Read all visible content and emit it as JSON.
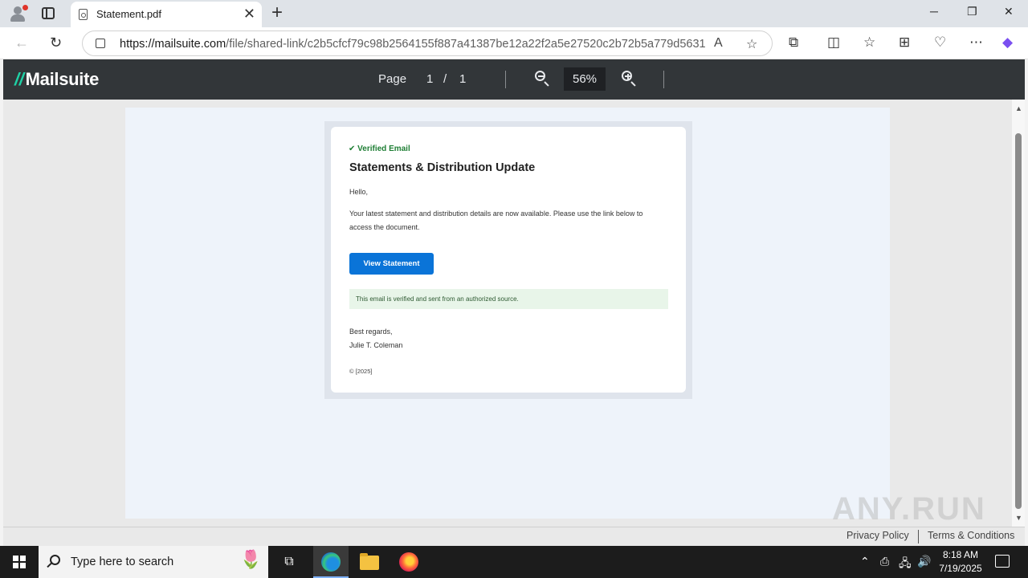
{
  "browser": {
    "tab_title": "Statement.pdf",
    "new_tab_symbol": "+",
    "close_symbol": "✕",
    "url_domain": "https://mailsuite.com",
    "url_path": "/file/shared-link/c2b5cfcf79c98b2564155f887a41387be12a22f2a5e27520c2b72b5a779d5631?...",
    "window_controls": {
      "minimize": "─",
      "restore": "❐",
      "close": "✕"
    }
  },
  "viewer": {
    "logo_text": "Mailsuite",
    "logo_mark": "//",
    "page_label": "Page",
    "current_page": "1",
    "page_separator": "/",
    "total_pages": "1",
    "zoom": "56%"
  },
  "email": {
    "verified_badge": "✔ Verified Email",
    "subject": "Statements & Distribution Update",
    "greeting": "Hello,",
    "body": "Your latest statement and distribution details are now available. Please use the link below to access the document.",
    "cta_label": "View Statement",
    "notice": "This email is verified and sent from an authorized source.",
    "closing": "Best regards,",
    "signer": "Julie T. Coleman",
    "copyright": "© [2025]"
  },
  "footer": {
    "privacy": "Privacy Policy",
    "terms": "Terms & Conditions",
    "watermark": "ANY.RUN"
  },
  "taskbar": {
    "search_placeholder": "Type here to search",
    "time": "8:18 AM",
    "date": "7/19/2025"
  },
  "colors": {
    "viewer_header": "#323639",
    "cta_blue": "#0a74d8",
    "verified_green": "#1e7e34",
    "notice_bg": "#e8f5e9"
  },
  "icons": [
    "profile-icon",
    "tab-actions-icon",
    "pdf-file-icon",
    "back-icon",
    "refresh-icon",
    "lock-icon",
    "read-aloud-icon",
    "favorite-star-icon",
    "extensions-icon",
    "split-screen-icon",
    "favorites-icon",
    "collections-icon",
    "browser-essentials-icon",
    "more-icon",
    "copilot-icon",
    "zoom-out-icon",
    "zoom-in-icon",
    "windows-start-icon",
    "search-icon",
    "task-view-icon",
    "edge-icon",
    "file-explorer-icon",
    "firefox-icon",
    "chevron-up-icon",
    "network-icon",
    "volume-icon",
    "notification-icon"
  ]
}
